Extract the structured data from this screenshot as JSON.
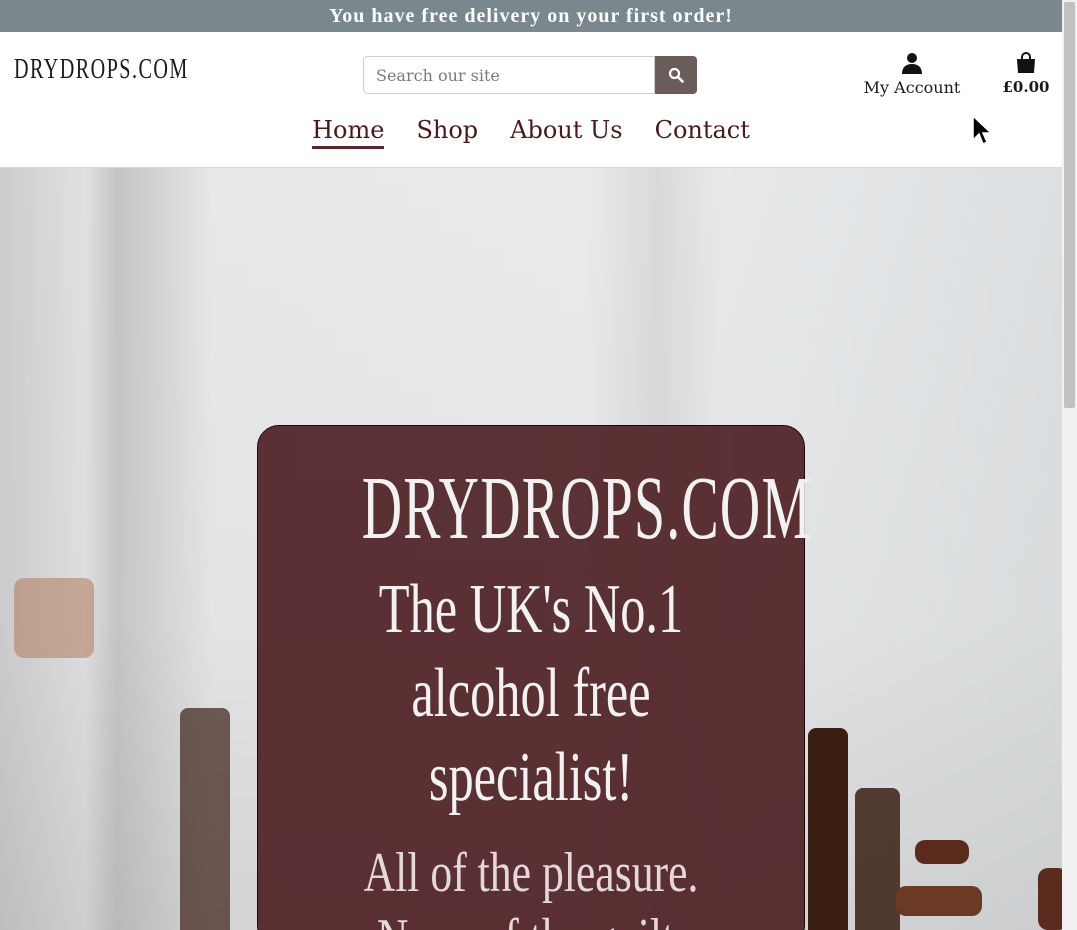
{
  "banner": {
    "text": "You have free delivery on your first order!"
  },
  "header": {
    "logo": "DRYDROPS.COM",
    "search": {
      "placeholder": "Search our site",
      "value": ""
    },
    "account_label": "My Account",
    "bag_total": "£0.00"
  },
  "nav": {
    "items": [
      {
        "label": "Home",
        "active": true
      },
      {
        "label": "Shop",
        "active": false
      },
      {
        "label": "About Us",
        "active": false
      },
      {
        "label": "Contact",
        "active": false
      }
    ]
  },
  "hero": {
    "title": "DRYDROPS.COM",
    "subtitle": "The UK's No.1 alcohol free specialist!",
    "tagline": "All of the pleasure. None of the guilt."
  },
  "colors": {
    "banner_bg": "#7a878d",
    "accent": "#4a1818",
    "hero_card": "#502226",
    "search_button": "#6b5c5c"
  },
  "icons": {
    "search": "search-icon",
    "account": "user-icon",
    "bag": "shopping-bag-icon"
  }
}
